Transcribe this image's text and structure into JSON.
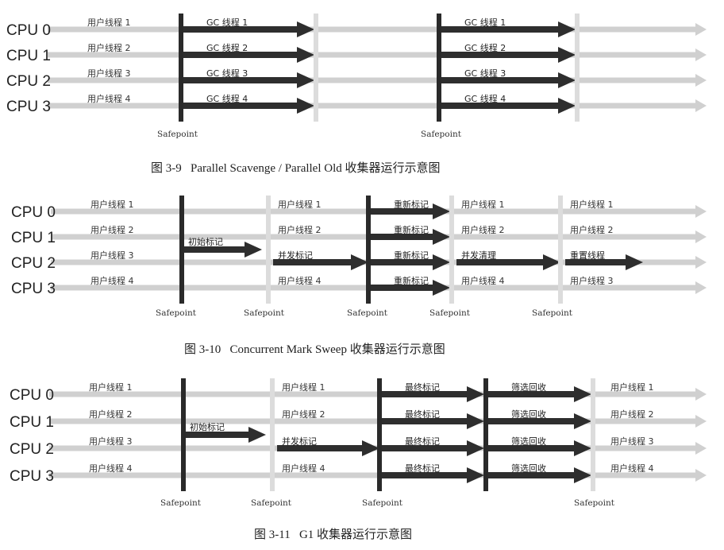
{
  "figures": [
    {
      "id": "fig-3-9",
      "caption": "图 3-9   Parallel Scavenge / Parallel Old 收集器运行示意图",
      "cpu_labels": [
        "CPU 0",
        "CPU 1",
        "CPU 2",
        "CPU 3"
      ],
      "safepoints": [
        "Safepoint",
        "Safepoint"
      ],
      "segments": [
        {
          "kind": "user",
          "labels": [
            "用户线程 1",
            "用户线程 2",
            "用户线程 3",
            "用户线程 4"
          ]
        },
        {
          "kind": "gc-all",
          "labels": [
            "GC 线程 1",
            "GC 线程 2",
            "GC 线程 3",
            "GC 线程 4"
          ]
        },
        {
          "kind": "user",
          "labels": [
            "",
            "",
            "",
            ""
          ]
        },
        {
          "kind": "gc-all",
          "labels": [
            "GC 线程 1",
            "GC 线程 2",
            "GC 线程 3",
            "GC 线程 4"
          ]
        },
        {
          "kind": "user",
          "labels": [
            "",
            "",
            "",
            ""
          ]
        }
      ]
    },
    {
      "id": "fig-3-10",
      "caption": "图 3-10   Concurrent Mark Sweep 收集器运行示意图",
      "cpu_labels": [
        "CPU 0",
        "CPU 1",
        "CPU 2",
        "CPU 3"
      ],
      "safepoints": [
        "Safepoint",
        "Safepoint",
        "Safepoint",
        "Safepoint",
        "Safepoint"
      ],
      "segments": [
        {
          "kind": "user",
          "labels": [
            "用户线程 1",
            "用户线程 2",
            "用户线程 3",
            "用户线程 4"
          ]
        },
        {
          "kind": "gc-single",
          "labels": [
            "初始标记"
          ]
        },
        {
          "kind": "mixed",
          "dark_row": 2,
          "labels": [
            "用户线程 1",
            "用户线程 2",
            "并发标记",
            "用户线程 4"
          ]
        },
        {
          "kind": "gc-all",
          "labels": [
            "重新标记",
            "重新标记",
            "重新标记",
            "重新标记"
          ]
        },
        {
          "kind": "mixed",
          "dark_row": 2,
          "labels": [
            "用户线程 1",
            "用户线程 2",
            "并发清理",
            "用户线程 4"
          ]
        },
        {
          "kind": "mixed",
          "dark_row": 2,
          "labels": [
            "用户线程 1",
            "用户线程 2",
            "重置线程",
            "用户线程 3"
          ]
        }
      ]
    },
    {
      "id": "fig-3-11",
      "caption": "图 3-11   G1 收集器运行示意图",
      "cpu_labels": [
        "CPU 0",
        "CPU 1",
        "CPU 2",
        "CPU 3"
      ],
      "safepoints": [
        "Safepoint",
        "Safepoint",
        "Safepoint",
        "Safepoint"
      ],
      "segments": [
        {
          "kind": "user",
          "labels": [
            "用户线程 1",
            "用户线程 2",
            "用户线程 3",
            "用户线程 4"
          ]
        },
        {
          "kind": "gc-single",
          "labels": [
            "初始标记"
          ]
        },
        {
          "kind": "mixed",
          "dark_row": 2,
          "labels": [
            "用户线程 1",
            "用户线程 2",
            "并发标记",
            "用户线程 4"
          ]
        },
        {
          "kind": "gc-all",
          "labels": [
            "最终标记",
            "最终标记",
            "最终标记",
            "最终标记"
          ]
        },
        {
          "kind": "gc-all",
          "labels": [
            "筛选回收",
            "筛选回收",
            "筛选回收",
            "筛选回收"
          ]
        },
        {
          "kind": "user",
          "labels": [
            "用户线程 1",
            "用户线程 2",
            "用户线程 3",
            "用户线程 4"
          ]
        }
      ]
    }
  ],
  "colors": {
    "user_thread": "#d0d0d0",
    "gc_thread": "#2e2e2e",
    "safepoint_bar": "#2a2a2a",
    "safepoint_light": "#dcdcdc"
  }
}
